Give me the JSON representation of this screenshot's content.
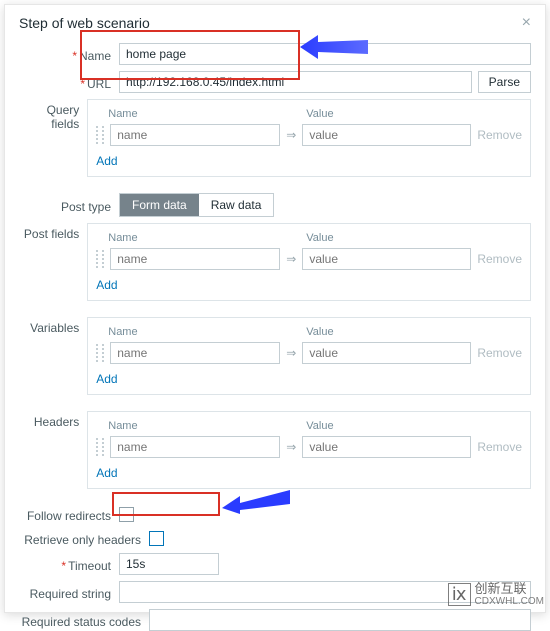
{
  "dialog": {
    "title": "Step of web scenario",
    "close": "×"
  },
  "labels": {
    "name": "Name",
    "url": "URL",
    "query_fields": "Query fields",
    "post_type": "Post type",
    "post_fields": "Post fields",
    "variables": "Variables",
    "headers": "Headers",
    "follow_redirects": "Follow redirects",
    "retrieve_only_headers": "Retrieve only headers",
    "timeout": "Timeout",
    "required_string": "Required string",
    "required_status_codes": "Required status codes"
  },
  "values": {
    "name": "home page",
    "url": "http://192.168.0.45/index.html",
    "timeout": "15s",
    "required_string": "",
    "required_status_codes": ""
  },
  "buttons": {
    "parse": "Parse"
  },
  "pairbox": {
    "name_header": "Name",
    "value_header": "Value",
    "name_ph": "name",
    "value_ph": "value",
    "remove": "Remove",
    "add": "Add",
    "sep": "⇒"
  },
  "post_type": {
    "form_data": "Form data",
    "raw_data": "Raw data"
  },
  "watermark": {
    "icon": "ⅸ",
    "line1": "创新互联",
    "line2": "CDXWHL.COM"
  }
}
